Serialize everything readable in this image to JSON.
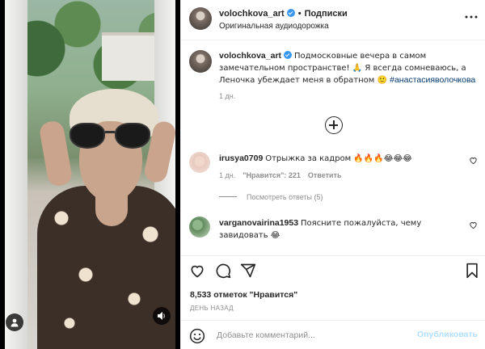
{
  "post": {
    "username": "volochkova_art",
    "separator": "•",
    "follow_label": "Подписки",
    "audio_label": "Оригинальная аудиодорожка"
  },
  "caption": {
    "username": "volochkova_art",
    "text": "Подмосковные вечера в самом замечательном пространстве! 🙏 Я всегда сомневаюсь, а Леночка убеждает меня в обратном 🙂 ",
    "hashtag": "#анастасияволочкова",
    "time": "1 дн."
  },
  "comments": [
    {
      "username": "irusya0709",
      "text": "Отрыжка за кадром 🔥🔥🔥😂😂😂",
      "time": "1 дн.",
      "likes": "\"Нравится\": 221",
      "reply_label": "Ответить",
      "view_replies": "Посмотреть ответы (5)"
    },
    {
      "username": "varganovairina1953",
      "text": "Поясните пожалуйста, чему завидовать 😂"
    }
  ],
  "stats": {
    "likes": "8,533 отметок \"Нравится\"",
    "posted": "ДЕНЬ НАЗАД"
  },
  "add_comment": {
    "placeholder": "Добавьте комментарий...",
    "publish_label": "Опубликовать"
  },
  "colors": {
    "text": "#262626",
    "muted": "#8e8e8e",
    "link": "#00376b",
    "verified": "#3897f0",
    "publish_disabled": "#b2dffc"
  },
  "icons": [
    "more-icon",
    "verified-icon",
    "add-comments-icon",
    "heart-icon",
    "comment-icon",
    "share-icon",
    "bookmark-icon",
    "emoji-icon",
    "user-tag-icon",
    "sound-icon"
  ]
}
